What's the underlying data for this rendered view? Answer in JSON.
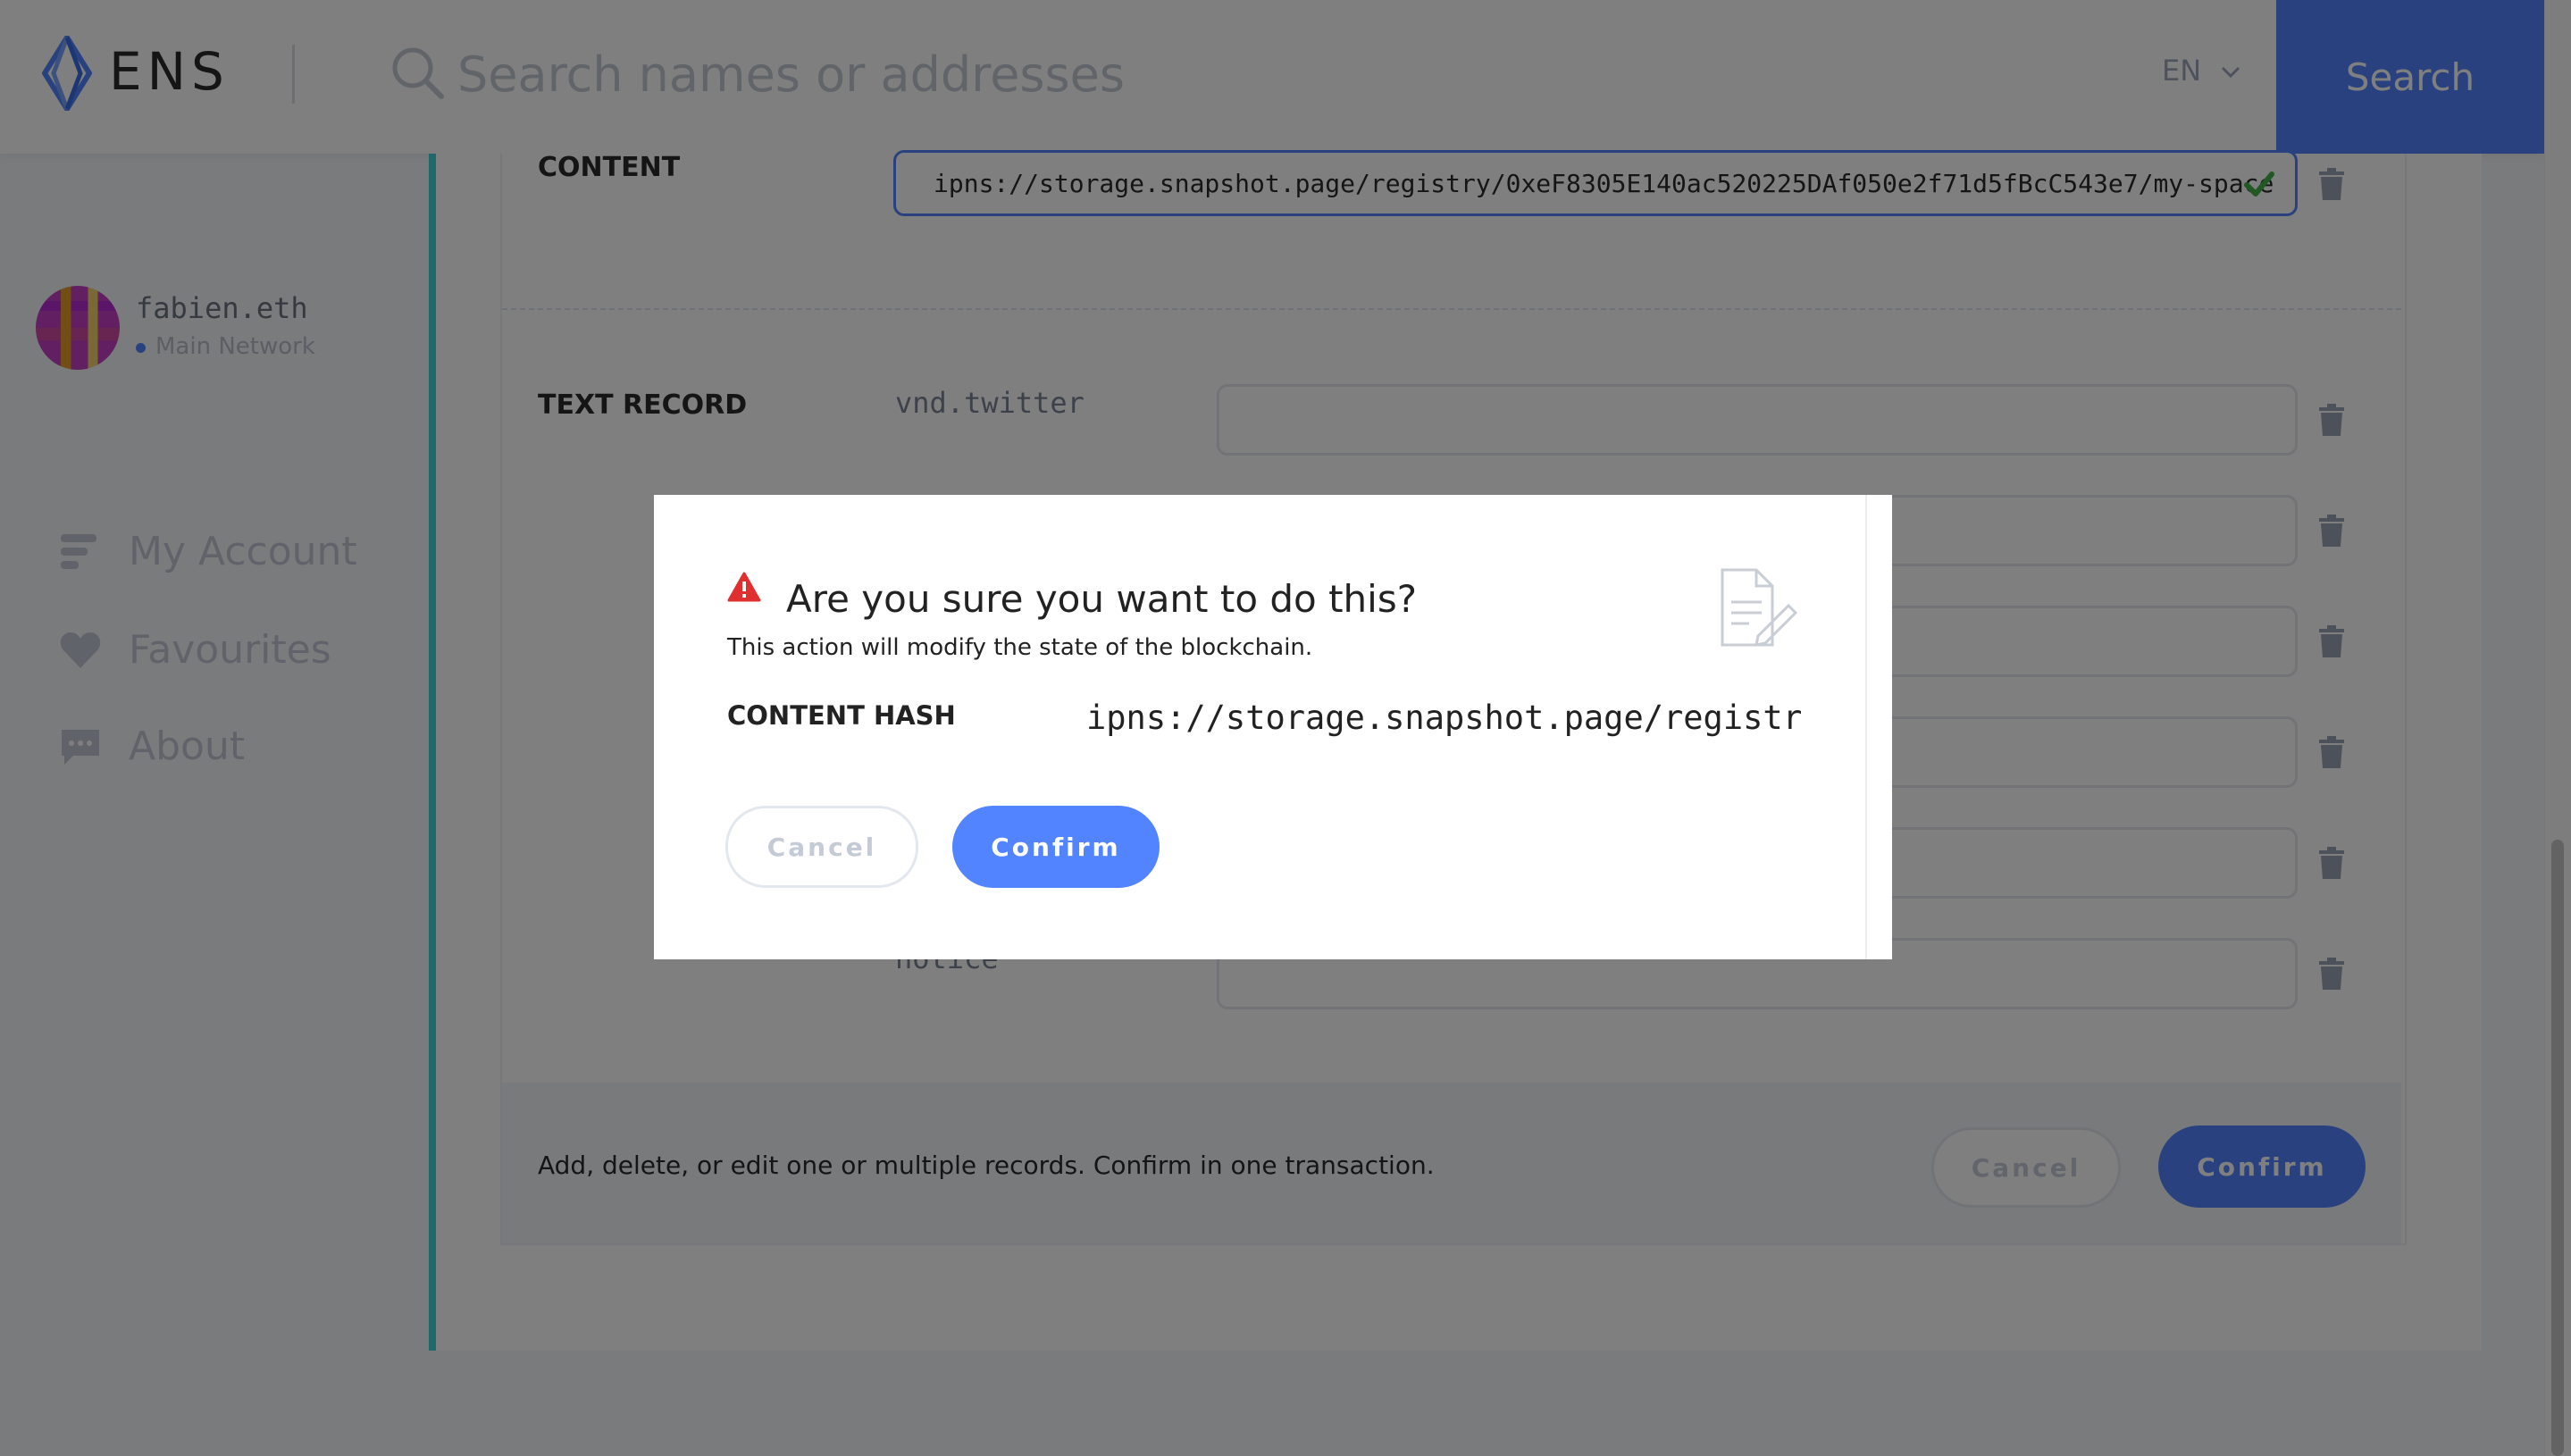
{
  "header": {
    "logo_text": "ENS",
    "search_placeholder": "Search names or addresses",
    "language": "EN",
    "search_button": "Search"
  },
  "sidebar": {
    "account": {
      "name": "fabien.eth",
      "network": "Main Network"
    },
    "nav": [
      {
        "label": "My Account",
        "icon": "account-icon"
      },
      {
        "label": "Favourites",
        "icon": "heart-icon"
      },
      {
        "label": "About",
        "icon": "chat-icon"
      }
    ]
  },
  "records": {
    "content_label": "CONTENT",
    "content_value": "ipns://storage.snapshot.page/registry/0xeF8305E140ac520225DAf050e2f71d5fBcC543e7/my-space",
    "text_record_label": "TEXT RECORD",
    "text_keys": [
      "vnd.twitter",
      "notice"
    ],
    "footer_text": "Add, delete, or edit one or multiple records. Confirm in one transaction.",
    "cancel": "Cancel",
    "confirm": "Confirm"
  },
  "modal": {
    "title": "Are you sure you want to do this?",
    "subtitle": "This action will modify the state of the blockchain.",
    "field_label": "CONTENT HASH",
    "field_value": "ipns://storage.snapshot.page/registr",
    "cancel": "Cancel",
    "confirm": "Confirm"
  },
  "colors": {
    "primary": "#5284ff",
    "accent_border": "#40d1d7",
    "warning": "#e02f2f",
    "valid_check": "#42b14b"
  }
}
